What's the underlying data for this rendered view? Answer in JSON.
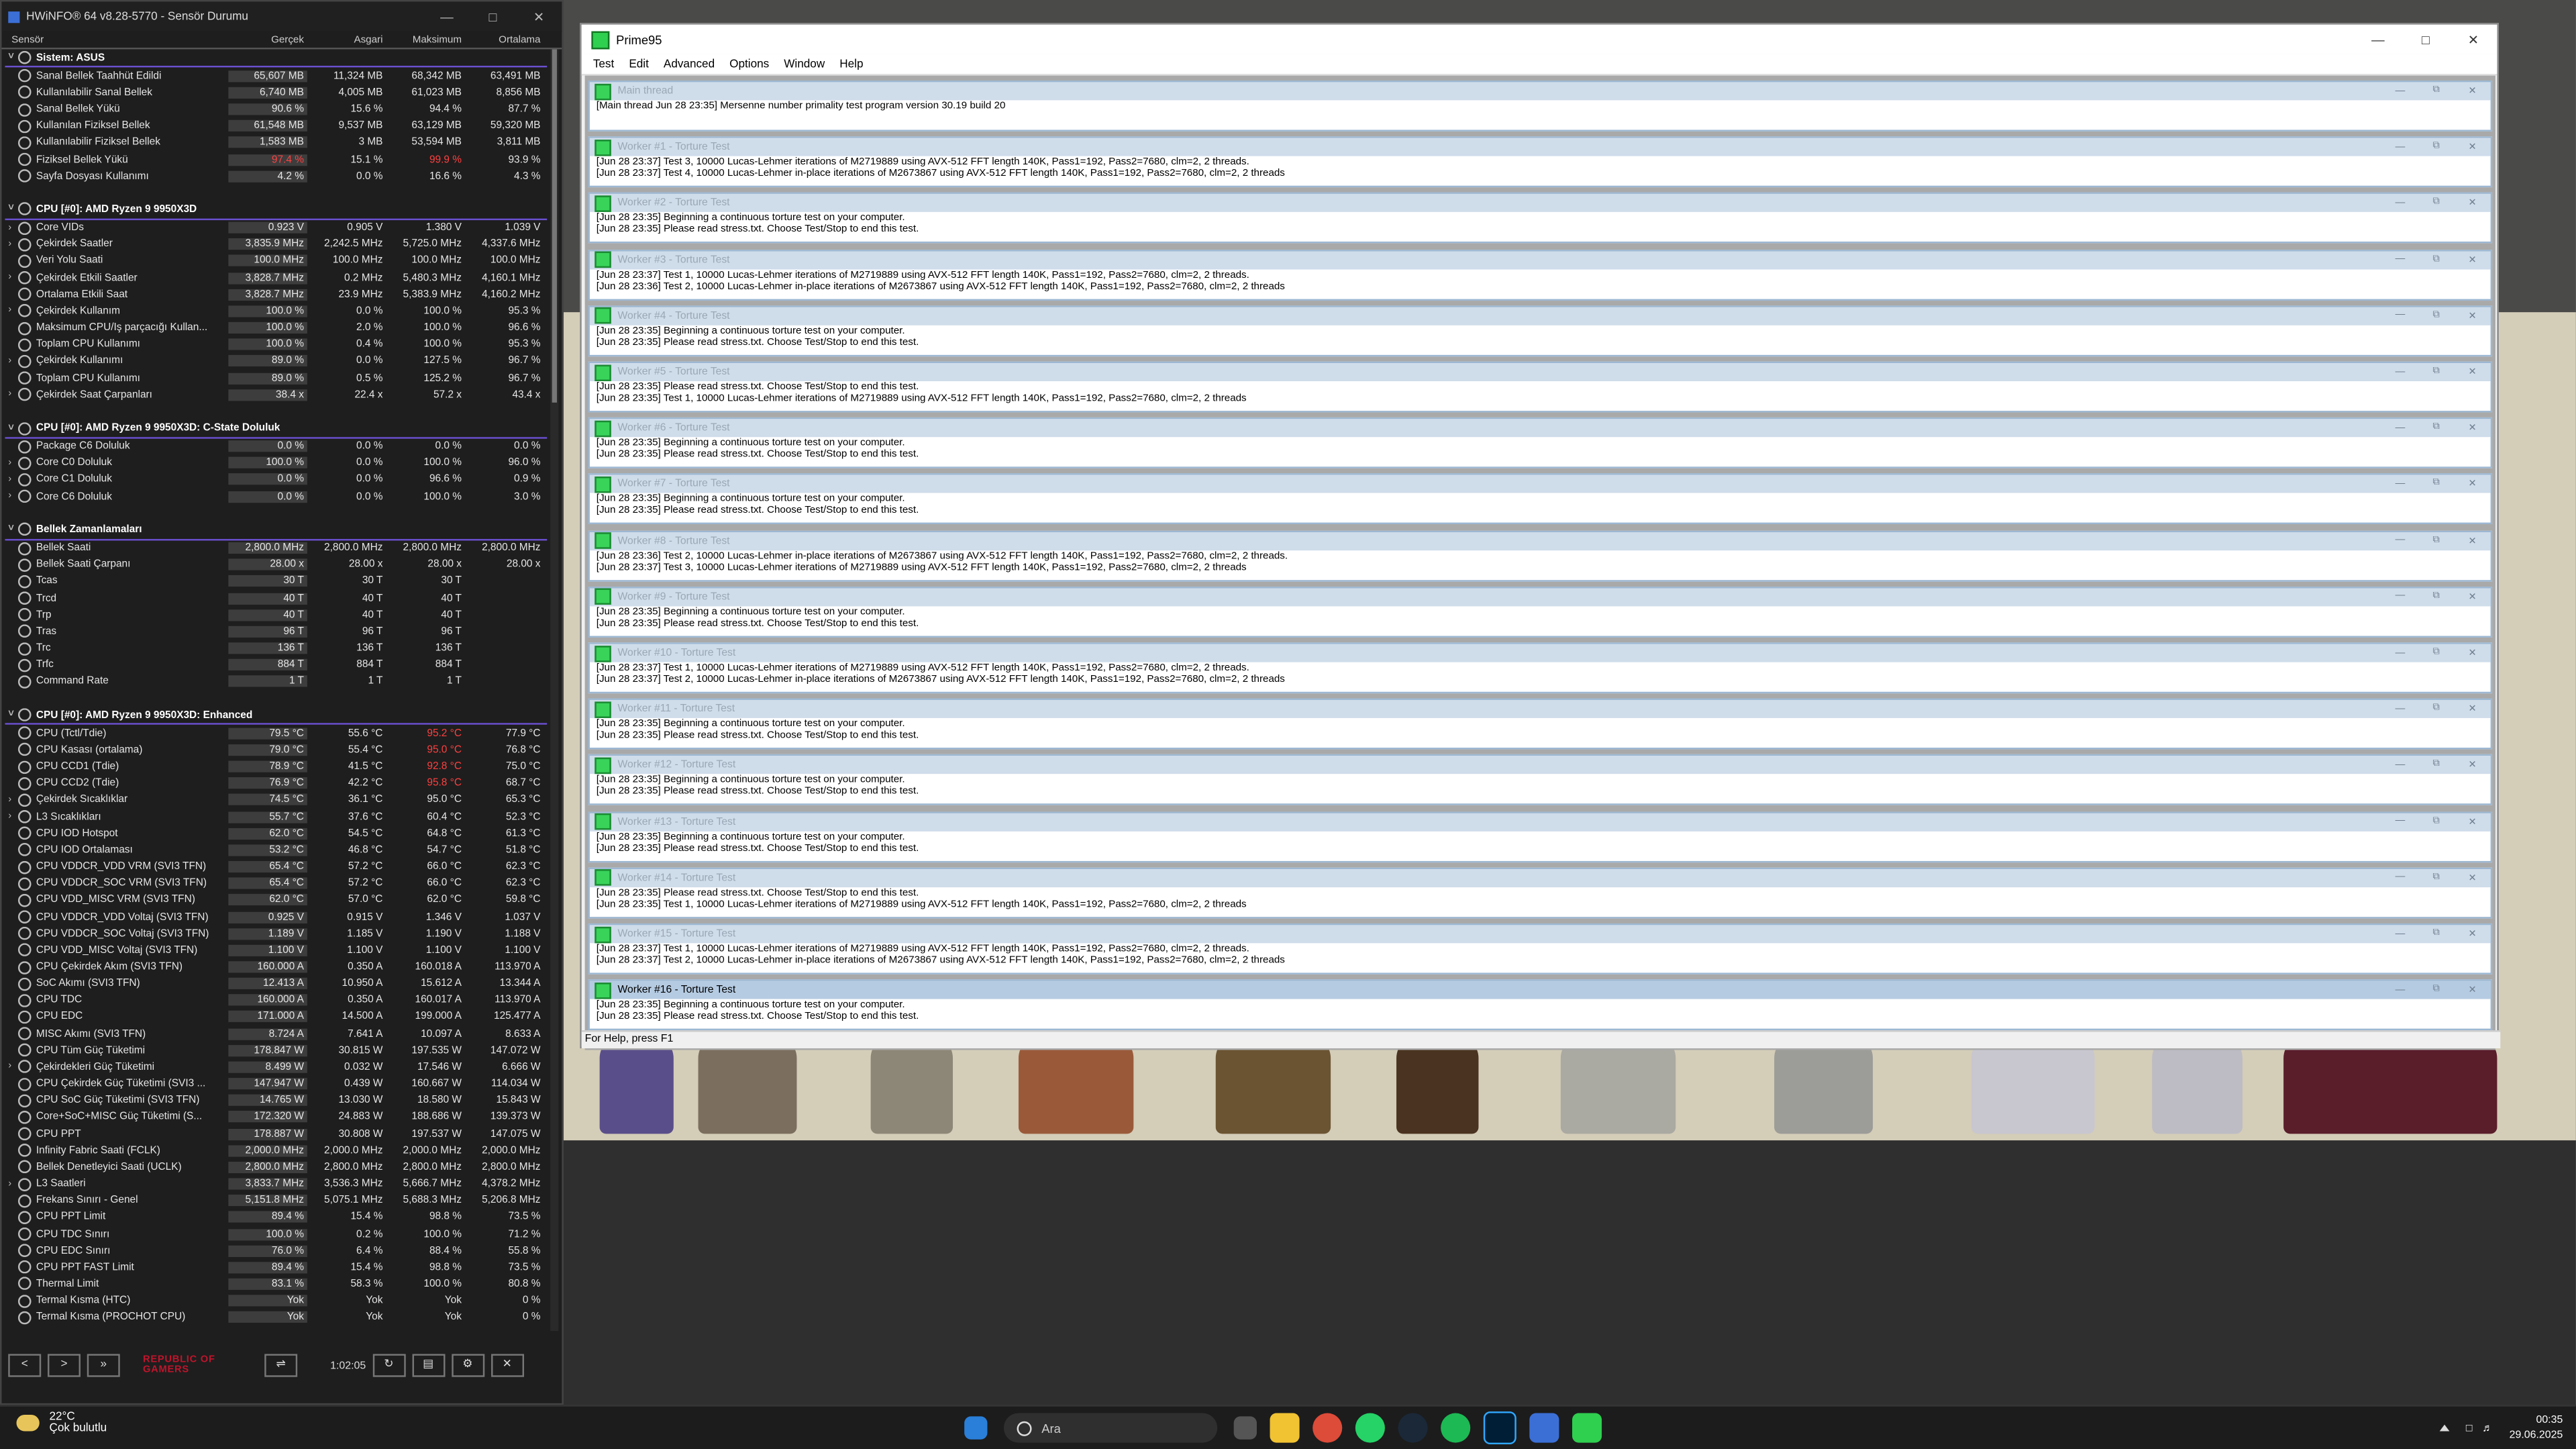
{
  "hwinfo": {
    "title": "HWiNFO® 64 v8.28-5770 - Sensör Durumu",
    "columns": [
      "Sensör",
      "Gerçek",
      "Asgari",
      "Maksimum",
      "Ortalama"
    ],
    "rows": [
      {
        "type": "group",
        "name": "Sistem: ASUS"
      },
      {
        "name": "Sanal Bellek Taahhüt Edildi",
        "v": [
          "65,607 MB",
          "11,324 MB",
          "68,342 MB",
          "63,491 MB"
        ]
      },
      {
        "name": "Kullanılabilir Sanal Bellek",
        "v": [
          "6,740 MB",
          "4,005 MB",
          "61,023 MB",
          "8,856 MB"
        ]
      },
      {
        "name": "Sanal Bellek Yükü",
        "v": [
          "90.6 %",
          "15.6 %",
          "94.4 %",
          "87.7 %"
        ]
      },
      {
        "name": "Kullanılan Fiziksel Bellek",
        "v": [
          "61,548 MB",
          "9,537 MB",
          "63,129 MB",
          "59,320 MB"
        ]
      },
      {
        "name": "Kullanılabilir Fiziksel Bellek",
        "v": [
          "1,583 MB",
          "3 MB",
          "53,594 MB",
          "3,811 MB"
        ]
      },
      {
        "name": "Fiziksel Bellek Yükü",
        "v": [
          "97.4 %",
          "15.1 %",
          "99.9 %",
          "93.9 %"
        ],
        "red": [
          0,
          2
        ]
      },
      {
        "name": "Sayfa Dosyası Kullanımı",
        "v": [
          "4.2 %",
          "0.0 %",
          "16.6 %",
          "4.3 %"
        ]
      },
      {
        "type": "gap"
      },
      {
        "type": "group",
        "name": "CPU [#0]: AMD Ryzen 9 9950X3D"
      },
      {
        "name": "Core VIDs",
        "v": [
          "0.923 V",
          "0.905 V",
          "1.380 V",
          "1.039 V"
        ],
        "exp": true
      },
      {
        "name": "Çekirdek Saatler",
        "v": [
          "3,835.9 MHz",
          "2,242.5 MHz",
          "5,725.0 MHz",
          "4,337.6 MHz"
        ],
        "exp": true
      },
      {
        "name": "Veri Yolu Saati",
        "v": [
          "100.0 MHz",
          "100.0 MHz",
          "100.0 MHz",
          "100.0 MHz"
        ]
      },
      {
        "name": "Çekirdek Etkili Saatler",
        "v": [
          "3,828.7 MHz",
          "0.2 MHz",
          "5,480.3 MHz",
          "4,160.1 MHz"
        ],
        "exp": true
      },
      {
        "name": "Ortalama Etkili Saat",
        "v": [
          "3,828.7 MHz",
          "23.9 MHz",
          "5,383.9 MHz",
          "4,160.2 MHz"
        ]
      },
      {
        "name": "Çekirdek Kullanım",
        "v": [
          "100.0 %",
          "0.0 %",
          "100.0 %",
          "95.3 %"
        ],
        "exp": true
      },
      {
        "name": "Maksimum CPU/İş parçacığı Kullan...",
        "v": [
          "100.0 %",
          "2.0 %",
          "100.0 %",
          "96.6 %"
        ]
      },
      {
        "name": "Toplam CPU Kullanımı",
        "v": [
          "100.0 %",
          "0.4 %",
          "100.0 %",
          "95.3 %"
        ]
      },
      {
        "name": "Çekirdek Kullanımı",
        "v": [
          "89.0 %",
          "0.0 %",
          "127.5 %",
          "96.7 %"
        ],
        "exp": true
      },
      {
        "name": "Toplam CPU Kullanımı",
        "v": [
          "89.0 %",
          "0.5 %",
          "125.2 %",
          "96.7 %"
        ]
      },
      {
        "name": "Çekirdek Saat Çarpanları",
        "v": [
          "38.4 x",
          "22.4 x",
          "57.2 x",
          "43.4 x"
        ],
        "exp": true
      },
      {
        "type": "gap"
      },
      {
        "type": "group",
        "name": "CPU [#0]: AMD Ryzen 9 9950X3D: C-State Doluluk"
      },
      {
        "name": "Package C6 Doluluk",
        "v": [
          "0.0 %",
          "0.0 %",
          "0.0 %",
          "0.0 %"
        ]
      },
      {
        "name": "Core C0 Doluluk",
        "v": [
          "100.0 %",
          "0.0 %",
          "100.0 %",
          "96.0 %"
        ],
        "exp": true
      },
      {
        "name": "Core C1 Doluluk",
        "v": [
          "0.0 %",
          "0.0 %",
          "96.6 %",
          "0.9 %"
        ],
        "exp": true
      },
      {
        "name": "Core C6 Doluluk",
        "v": [
          "0.0 %",
          "0.0 %",
          "100.0 %",
          "3.0 %"
        ],
        "exp": true
      },
      {
        "type": "gap"
      },
      {
        "type": "group",
        "name": "Bellek Zamanlamaları"
      },
      {
        "name": "Bellek Saati",
        "v": [
          "2,800.0 MHz",
          "2,800.0 MHz",
          "2,800.0 MHz",
          "2,800.0 MHz"
        ]
      },
      {
        "name": "Bellek Saati Çarpanı",
        "v": [
          "28.00 x",
          "28.00 x",
          "28.00 x",
          "28.00 x"
        ]
      },
      {
        "name": "Tcas",
        "v": [
          "30 T",
          "30 T",
          "30 T",
          ""
        ]
      },
      {
        "name": "Trcd",
        "v": [
          "40 T",
          "40 T",
          "40 T",
          ""
        ]
      },
      {
        "name": "Trp",
        "v": [
          "40 T",
          "40 T",
          "40 T",
          ""
        ]
      },
      {
        "name": "Tras",
        "v": [
          "96 T",
          "96 T",
          "96 T",
          ""
        ]
      },
      {
        "name": "Trc",
        "v": [
          "136 T",
          "136 T",
          "136 T",
          ""
        ]
      },
      {
        "name": "Trfc",
        "v": [
          "884 T",
          "884 T",
          "884 T",
          ""
        ]
      },
      {
        "name": "Command Rate",
        "v": [
          "1 T",
          "1 T",
          "1 T",
          ""
        ]
      },
      {
        "type": "gap"
      },
      {
        "type": "group",
        "name": "CPU [#0]: AMD Ryzen 9 9950X3D: Enhanced"
      },
      {
        "name": "CPU (Tctl/Tdie)",
        "v": [
          "79.5 °C",
          "55.6 °C",
          "95.2 °C",
          "77.9 °C"
        ],
        "red": [
          2
        ]
      },
      {
        "name": "CPU Kasası (ortalama)",
        "v": [
          "79.0 °C",
          "55.4 °C",
          "95.0 °C",
          "76.8 °C"
        ],
        "red": [
          2
        ]
      },
      {
        "name": "CPU CCD1 (Tdie)",
        "v": [
          "78.9 °C",
          "41.5 °C",
          "92.8 °C",
          "75.0 °C"
        ],
        "red": [
          2
        ]
      },
      {
        "name": "CPU CCD2 (Tdie)",
        "v": [
          "76.9 °C",
          "42.2 °C",
          "95.8 °C",
          "68.7 °C"
        ],
        "red": [
          2
        ]
      },
      {
        "name": "Çekirdek Sıcaklıklar",
        "v": [
          "74.5 °C",
          "36.1 °C",
          "95.0 °C",
          "65.3 °C"
        ],
        "exp": true
      },
      {
        "name": "L3 Sıcaklıkları",
        "v": [
          "55.7 °C",
          "37.6 °C",
          "60.4 °C",
          "52.3 °C"
        ],
        "exp": true
      },
      {
        "name": "CPU IOD Hotspot",
        "v": [
          "62.0 °C",
          "54.5 °C",
          "64.8 °C",
          "61.3 °C"
        ]
      },
      {
        "name": "CPU IOD Ortalaması",
        "v": [
          "53.2 °C",
          "46.8 °C",
          "54.7 °C",
          "51.8 °C"
        ]
      },
      {
        "name": "CPU VDDCR_VDD VRM (SVI3 TFN)",
        "v": [
          "65.4 °C",
          "57.2 °C",
          "66.0 °C",
          "62.3 °C"
        ]
      },
      {
        "name": "CPU VDDCR_SOC VRM (SVI3 TFN)",
        "v": [
          "65.4 °C",
          "57.2 °C",
          "66.0 °C",
          "62.3 °C"
        ]
      },
      {
        "name": "CPU VDD_MISC VRM (SVI3 TFN)",
        "v": [
          "62.0 °C",
          "57.0 °C",
          "62.0 °C",
          "59.8 °C"
        ]
      },
      {
        "name": "CPU VDDCR_VDD Voltaj (SVI3 TFN)",
        "v": [
          "0.925 V",
          "0.915 V",
          "1.346 V",
          "1.037 V"
        ]
      },
      {
        "name": "CPU VDDCR_SOC Voltaj (SVI3 TFN)",
        "v": [
          "1.189 V",
          "1.185 V",
          "1.190 V",
          "1.188 V"
        ]
      },
      {
        "name": "CPU VDD_MISC Voltaj (SVI3 TFN)",
        "v": [
          "1.100 V",
          "1.100 V",
          "1.100 V",
          "1.100 V"
        ]
      },
      {
        "name": "CPU Çekirdek Akım (SVI3 TFN)",
        "v": [
          "160.000 A",
          "0.350 A",
          "160.018 A",
          "113.970 A"
        ]
      },
      {
        "name": "SoC Akımı (SVI3 TFN)",
        "v": [
          "12.413 A",
          "10.950 A",
          "15.612 A",
          "13.344 A"
        ]
      },
      {
        "name": "CPU TDC",
        "v": [
          "160.000 A",
          "0.350 A",
          "160.017 A",
          "113.970 A"
        ]
      },
      {
        "name": "CPU EDC",
        "v": [
          "171.000 A",
          "14.500 A",
          "199.000 A",
          "125.477 A"
        ]
      },
      {
        "name": "MISC Akımı (SVI3 TFN)",
        "v": [
          "8.724 A",
          "7.641 A",
          "10.097 A",
          "8.633 A"
        ]
      },
      {
        "name": "CPU Tüm Güç Tüketimi",
        "v": [
          "178.847 W",
          "30.815 W",
          "197.535 W",
          "147.072 W"
        ]
      },
      {
        "name": "Çekirdekleri Güç Tüketimi",
        "v": [
          "8.499 W",
          "0.032 W",
          "17.546 W",
          "6.666 W"
        ],
        "exp": true
      },
      {
        "name": "CPU Çekirdek Güç Tüketimi (SVI3 ...",
        "v": [
          "147.947 W",
          "0.439 W",
          "160.667 W",
          "114.034 W"
        ]
      },
      {
        "name": "CPU SoC Güç Tüketimi (SVI3 TFN)",
        "v": [
          "14.765 W",
          "13.030 W",
          "18.580 W",
          "15.843 W"
        ]
      },
      {
        "name": "Core+SoC+MISC Güç Tüketimi (S...",
        "v": [
          "172.320 W",
          "24.883 W",
          "188.686 W",
          "139.373 W"
        ]
      },
      {
        "name": "CPU PPT",
        "v": [
          "178.887 W",
          "30.808 W",
          "197.537 W",
          "147.075 W"
        ]
      },
      {
        "name": "Infinity Fabric Saati (FCLK)",
        "v": [
          "2,000.0 MHz",
          "2,000.0 MHz",
          "2,000.0 MHz",
          "2,000.0 MHz"
        ]
      },
      {
        "name": "Bellek Denetleyici Saati (UCLK)",
        "v": [
          "2,800.0 MHz",
          "2,800.0 MHz",
          "2,800.0 MHz",
          "2,800.0 MHz"
        ]
      },
      {
        "name": "L3 Saatleri",
        "v": [
          "3,833.7 MHz",
          "3,536.3 MHz",
          "5,666.7 MHz",
          "4,378.2 MHz"
        ],
        "exp": true
      },
      {
        "name": "Frekans Sınırı - Genel",
        "v": [
          "5,151.8 MHz",
          "5,075.1 MHz",
          "5,688.3 MHz",
          "5,206.8 MHz"
        ]
      },
      {
        "name": "CPU PPT Limit",
        "v": [
          "89.4 %",
          "15.4 %",
          "98.8 %",
          "73.5 %"
        ]
      },
      {
        "name": "CPU TDC Sınırı",
        "v": [
          "100.0 %",
          "0.2 %",
          "100.0 %",
          "71.2 %"
        ]
      },
      {
        "name": "CPU EDC Sınırı",
        "v": [
          "76.0 %",
          "6.4 %",
          "88.4 %",
          "55.8 %"
        ]
      },
      {
        "name": "CPU PPT FAST Limit",
        "v": [
          "89.4 %",
          "15.4 %",
          "98.8 %",
          "73.5 %"
        ]
      },
      {
        "name": "Thermal Limit",
        "v": [
          "83.1 %",
          "58.3 %",
          "100.0 %",
          "80.8 %"
        ]
      },
      {
        "name": "Termal Kısma (HTC)",
        "v": [
          "Yok",
          "Yok",
          "Yok",
          "0 %"
        ]
      },
      {
        "name": "Termal Kısma (PROCHOT CPU)",
        "v": [
          "Yok",
          "Yok",
          "Yok",
          "0 %"
        ]
      }
    ],
    "footer": {
      "brand": "REPUBLIC OF GAMERS",
      "timer": "1:02:05"
    }
  },
  "prime95": {
    "title": "Prime95",
    "menu": [
      "Test",
      "Edit",
      "Advanced",
      "Options",
      "Window",
      "Help"
    ],
    "status": "For Help, press F1",
    "windows": [
      {
        "title": "Main thread",
        "text": [
          "[Main thread Jun 28 23:35] Mersenne number primality test program version 30.19 build 20",
          ""
        ]
      },
      {
        "title": "Worker #1 - Torture Test",
        "text": [
          "[Jun 28 23:37] Test 3, 10000 Lucas-Lehmer iterations of M2719889 using AVX-512 FFT length 140K, Pass1=192, Pass2=7680, clm=2, 2 threads.",
          "[Jun 28 23:37] Test 4, 10000 Lucas-Lehmer in-place iterations of M2673867 using AVX-512 FFT length 140K, Pass1=192, Pass2=7680, clm=2, 2 threads"
        ]
      },
      {
        "title": "Worker #2 - Torture Test",
        "text": [
          "[Jun 28 23:35] Beginning a continuous torture test on your computer.",
          "[Jun 28 23:35] Please read stress.txt.  Choose Test/Stop to end this test."
        ]
      },
      {
        "title": "Worker #3 - Torture Test",
        "text": [
          "[Jun 28 23:37] Test 1, 10000 Lucas-Lehmer iterations of M2719889 using AVX-512 FFT length 140K, Pass1=192, Pass2=7680, clm=2, 2 threads.",
          "[Jun 28 23:36] Test 2, 10000 Lucas-Lehmer in-place iterations of M2673867 using AVX-512 FFT length 140K, Pass1=192, Pass2=7680, clm=2, 2 threads"
        ]
      },
      {
        "title": "Worker #4 - Torture Test",
        "text": [
          "[Jun 28 23:35] Beginning a continuous torture test on your computer.",
          "[Jun 28 23:35] Please read stress.txt.  Choose Test/Stop to end this test."
        ]
      },
      {
        "title": "Worker #5 - Torture Test",
        "text": [
          "[Jun 28 23:35] Please read stress.txt.  Choose Test/Stop to end this test.",
          "[Jun 28 23:35] Test 1, 10000 Lucas-Lehmer iterations of M2719889 using AVX-512 FFT length 140K, Pass1=192, Pass2=7680, clm=2, 2 threads"
        ]
      },
      {
        "title": "Worker #6 - Torture Test",
        "text": [
          "[Jun 28 23:35] Beginning a continuous torture test on your computer.",
          "[Jun 28 23:35] Please read stress.txt.  Choose Test/Stop to end this test."
        ]
      },
      {
        "title": "Worker #7 - Torture Test",
        "text": [
          "[Jun 28 23:35] Beginning a continuous torture test on your computer.",
          "[Jun 28 23:35] Please read stress.txt.  Choose Test/Stop to end this test."
        ]
      },
      {
        "title": "Worker #8 - Torture Test",
        "text": [
          "[Jun 28 23:36] Test 2, 10000 Lucas-Lehmer in-place iterations of M2673867 using AVX-512 FFT length 140K, Pass1=192, Pass2=7680, clm=2, 2 threads.",
          "[Jun 28 23:37] Test 3, 10000 Lucas-Lehmer iterations of M2719889 using AVX-512 FFT length 140K, Pass1=192, Pass2=7680, clm=2, 2 threads"
        ]
      },
      {
        "title": "Worker #9 - Torture Test",
        "text": [
          "[Jun 28 23:35] Beginning a continuous torture test on your computer.",
          "[Jun 28 23:35] Please read stress.txt.  Choose Test/Stop to end this test."
        ]
      },
      {
        "title": "Worker #10 - Torture Test",
        "text": [
          "[Jun 28 23:37] Test 1, 10000 Lucas-Lehmer iterations of M2719889 using AVX-512 FFT length 140K, Pass1=192, Pass2=7680, clm=2, 2 threads.",
          "[Jun 28 23:37] Test 2, 10000 Lucas-Lehmer in-place iterations of M2673867 using AVX-512 FFT length 140K, Pass1=192, Pass2=7680, clm=2, 2 threads"
        ]
      },
      {
        "title": "Worker #11 - Torture Test",
        "text": [
          "[Jun 28 23:35] Beginning a continuous torture test on your computer.",
          "[Jun 28 23:35] Please read stress.txt.  Choose Test/Stop to end this test."
        ]
      },
      {
        "title": "Worker #12 - Torture Test",
        "text": [
          "[Jun 28 23:35] Beginning a continuous torture test on your computer.",
          "[Jun 28 23:35] Please read stress.txt.  Choose Test/Stop to end this test."
        ]
      },
      {
        "title": "Worker #13 - Torture Test",
        "text": [
          "[Jun 28 23:35] Beginning a continuous torture test on your computer.",
          "[Jun 28 23:35] Please read stress.txt.  Choose Test/Stop to end this test."
        ]
      },
      {
        "title": "Worker #14 - Torture Test",
        "text": [
          "[Jun 28 23:35] Please read stress.txt.  Choose Test/Stop to end this test.",
          "[Jun 28 23:35] Test 1, 10000 Lucas-Lehmer iterations of M2719889 using AVX-512 FFT length 140K, Pass1=192, Pass2=7680, clm=2, 2 threads"
        ]
      },
      {
        "title": "Worker #15 - Torture Test",
        "text": [
          "[Jun 28 23:37] Test 1, 10000 Lucas-Lehmer iterations of M2719889 using AVX-512 FFT length 140K, Pass1=192, Pass2=7680, clm=2, 2 threads.",
          "[Jun 28 23:37] Test 2, 10000 Lucas-Lehmer in-place iterations of M2673867 using AVX-512 FFT length 140K, Pass1=192, Pass2=7680, clm=2, 2 threads"
        ]
      },
      {
        "title": "Worker #16 - Torture Test",
        "text": [
          "[Jun 28 23:35] Beginning a continuous torture test on your computer.",
          "[Jun 28 23:35] Please read stress.txt.  Choose Test/Stop to end this test."
        ]
      }
    ]
  },
  "taskbar": {
    "temp": "22°C",
    "weather": "Çok bulutlu",
    "search": "Ara",
    "time": "00:35",
    "date": "29.06.2025",
    "apps": [
      "file-explorer-icon",
      "chrome-icon",
      "whatsapp-icon",
      "steam-icon",
      "spotify-icon",
      "photoshop-icon",
      "hwinfo-icon",
      "prime95-icon"
    ]
  },
  "colors": {
    "accent": "#6a4fcf",
    "hot": "#ff4040",
    "prime_green": "#2fcf4f"
  }
}
